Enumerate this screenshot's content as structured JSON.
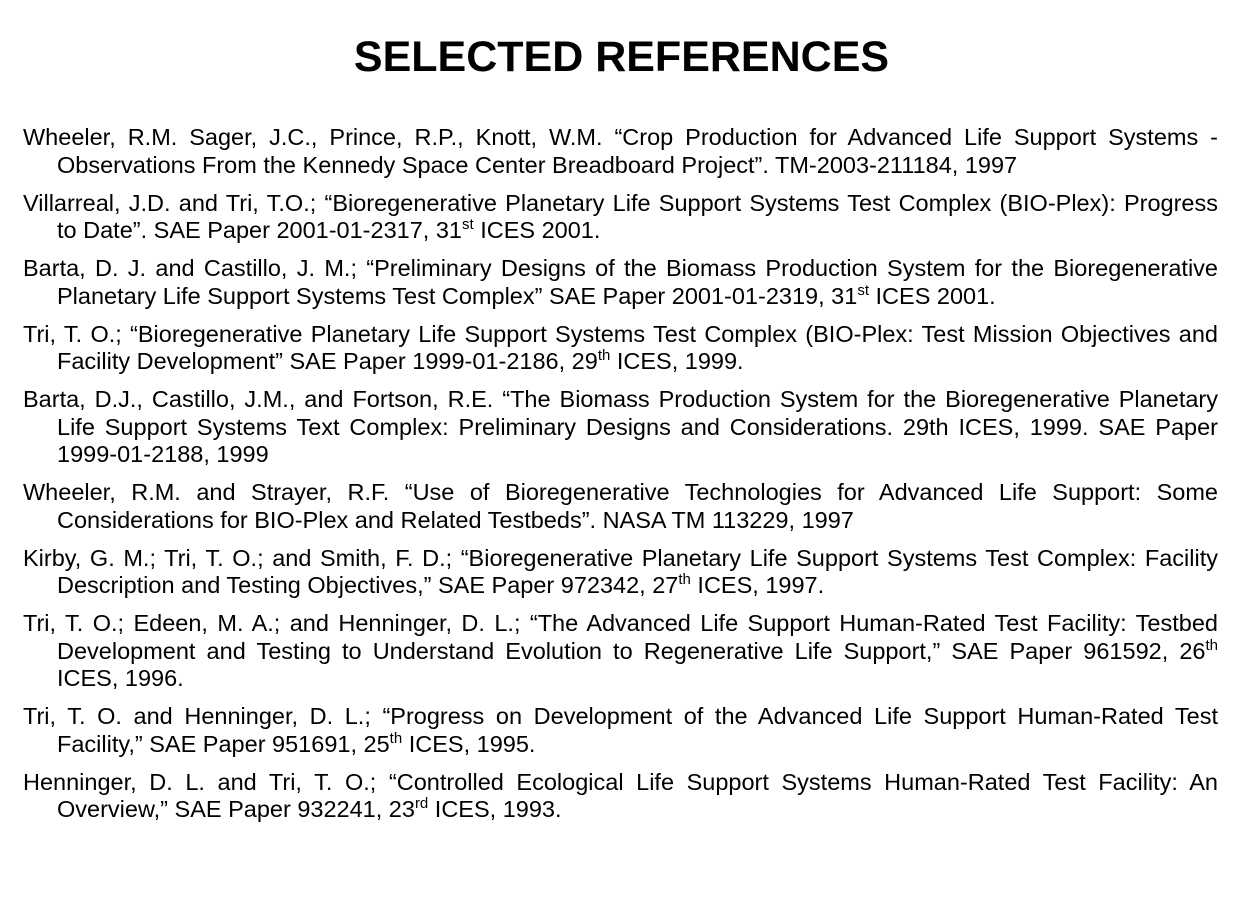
{
  "title": "SELECTED REFERENCES",
  "references": [
    {
      "text": "Wheeler, R.M. Sager, J.C., Prince, R.P., Knott, W.M. “Crop Production for Advanced Life Support Systems - Observations From the Kennedy Space Center Breadboard Project”. TM-2003-211184, 1997"
    },
    {
      "pre": "Villarreal, J.D. and Tri, T.O.; “Bioregenerative Planetary Life Support Systems Test Complex (BIO-Plex): Progress to Date”. SAE Paper 2001-01-2317, 31",
      "sup": "st",
      "post": " ICES 2001."
    },
    {
      "pre": "Barta, D. J. and Castillo, J. M.; “Preliminary Designs of the Biomass Production System for the Bioregenerative Planetary Life Support Systems Test Complex” SAE Paper 2001-01-2319, 31",
      "sup": "st",
      "post": " ICES 2001."
    },
    {
      "pre": "Tri, T. O.; “Bioregenerative Planetary Life Support Systems Test Complex (BIO-Plex: Test Mission Objectives and Facility Development” SAE Paper 1999-01-2186, 29",
      "sup": "th",
      "post": " ICES, 1999."
    },
    {
      "text": "Barta, D.J., Castillo, J.M., and Fortson, R.E. “The Biomass Production System for the Bioregenerative Planetary Life Support Systems Text Complex: Preliminary Designs and Considerations. 29th ICES, 1999. SAE Paper 1999-01-2188, 1999"
    },
    {
      "text": "Wheeler, R.M. and Strayer, R.F. “Use of Bioregenerative Technologies for Advanced Life Support: Some Considerations for BIO-Plex and Related Testbeds”. NASA TM 113229, 1997"
    },
    {
      "pre": "Kirby, G. M.; Tri, T. O.; and Smith, F. D.;  “Bioregenerative Planetary Life Support Systems Test Complex: Facility Description and Testing Objectives,” SAE Paper 972342, 27",
      "sup": "th",
      "post": " ICES, 1997."
    },
    {
      "pre": "Tri, T. O.; Edeen, M. A.; and Henninger, D. L.; “The Advanced Life Support Human-Rated Test Facility: Testbed Development and Testing to Understand Evolution to Regenerative Life Support,” SAE Paper 961592, 26",
      "sup": "th",
      "post": " ICES, 1996."
    },
    {
      "pre": "Tri, T. O. and Henninger, D. L.; “Progress on Development of the Advanced Life Support Human-Rated Test Facility,” SAE Paper 951691, 25",
      "sup": "th",
      "post": " ICES, 1995."
    },
    {
      "pre": "Henninger, D. L. and Tri, T. O.; “Controlled Ecological Life Support Systems Human-Rated Test Facility: An Overview,” SAE Paper 932241, 23",
      "sup": "rd",
      "post": " ICES, 1993."
    }
  ]
}
